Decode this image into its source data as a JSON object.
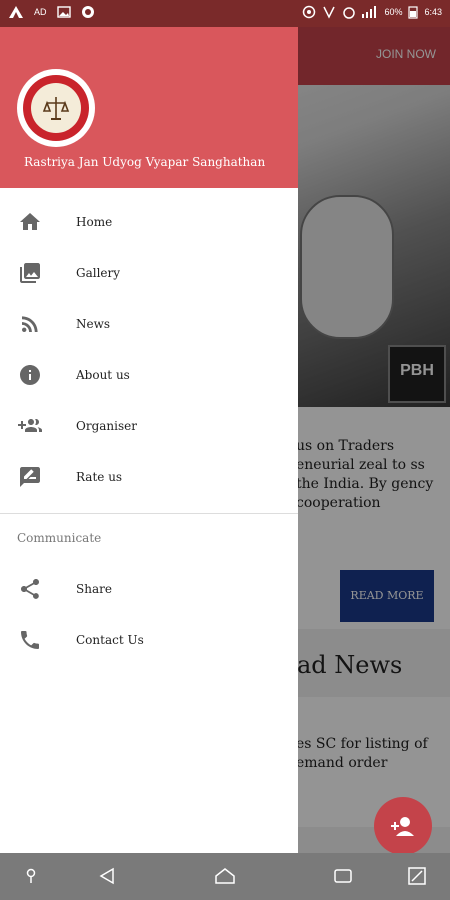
{
  "status_bar": {
    "left_icons": [
      "AD",
      "image-icon",
      "circle-icon"
    ],
    "battery": "60%",
    "time": "6:43"
  },
  "background_app": {
    "join_label": "JOIN NOW",
    "pbh_badge": "PBH",
    "card_text": "us on Traders eneurial zeal to ss the India. By gency cooperation",
    "read_more_label": "READ MORE",
    "news_heading": "ad News",
    "news_text": "es SC for listing of emand order"
  },
  "drawer": {
    "org_name": "Rastriya Jan Udyog Vyapar Sanghathan",
    "items": [
      {
        "label": "Home",
        "icon": "home-icon"
      },
      {
        "label": "Gallery",
        "icon": "gallery-icon"
      },
      {
        "label": "News",
        "icon": "rss-icon"
      },
      {
        "label": "About us",
        "icon": "info-icon"
      },
      {
        "label": "Organiser",
        "icon": "group-add-icon"
      },
      {
        "label": "Rate us",
        "icon": "rate-icon"
      }
    ],
    "section_label": "Communicate",
    "communicate_items": [
      {
        "label": "Share",
        "icon": "share-icon"
      },
      {
        "label": "Contact Us",
        "icon": "phone-icon"
      }
    ]
  },
  "colors": {
    "header": "#d9575c",
    "accent": "#c4434a",
    "read_more": "#1a3a8a"
  }
}
